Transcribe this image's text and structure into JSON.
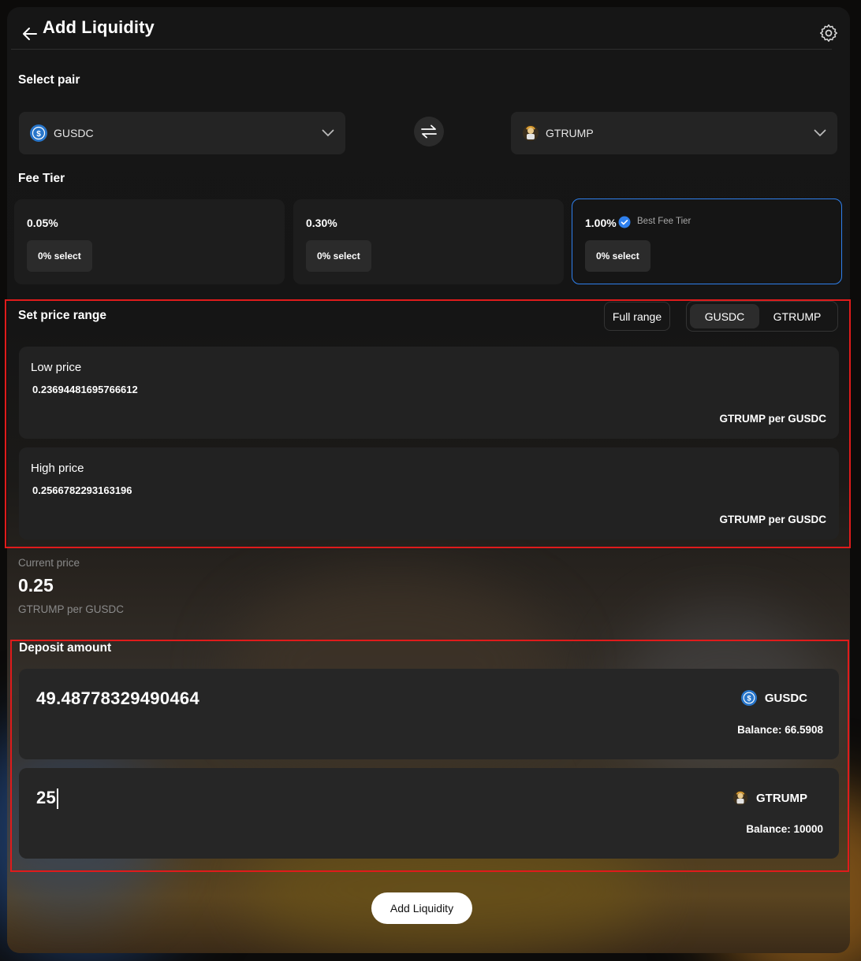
{
  "header": {
    "title": "Add Liquidity",
    "back_icon": "arrow-left-icon",
    "settings_icon": "gear-icon"
  },
  "pair": {
    "label": "Select pair",
    "token_a": {
      "symbol": "GUSDC",
      "icon": "usdc-coin-icon"
    },
    "token_b": {
      "symbol": "GTRUMP",
      "icon": "trump-token-icon"
    },
    "swap_icon": "swap-arrows-icon"
  },
  "fee_tier": {
    "label": "Fee Tier",
    "options": [
      {
        "pct": "0.05%",
        "select_label": "0% select"
      },
      {
        "pct": "0.30%",
        "select_label": "0% select"
      },
      {
        "pct": "1.00%",
        "select_label": "0% select",
        "badge": "Best Fee Tier",
        "selected": true
      }
    ],
    "accent": "#2f80ed"
  },
  "price_range": {
    "label": "Set price range",
    "full_range_label": "Full range",
    "toggle": [
      "GUSDC",
      "GTRUMP"
    ],
    "toggle_selected": "GUSDC",
    "low": {
      "label": "Low price",
      "value": "0.23694481695766612",
      "unit": "GTRUMP per GUSDC"
    },
    "high": {
      "label": "High price",
      "value": "0.2566782293163196",
      "unit": "GTRUMP per GUSDC"
    }
  },
  "current_price": {
    "label": "Current price",
    "value": "0.25",
    "unit": "GTRUMP per GUSDC"
  },
  "deposit": {
    "label": "Deposit amount",
    "token_a": {
      "amount": "49.48778329490464",
      "symbol": "GUSDC",
      "balance": "Balance: 66.5908"
    },
    "token_b": {
      "amount": "25",
      "symbol": "GTRUMP",
      "balance": "Balance: 10000"
    }
  },
  "submit_label": "Add Liquidity",
  "colors": {
    "highlight_frame": "#e01b1b",
    "panel": "#161616"
  }
}
